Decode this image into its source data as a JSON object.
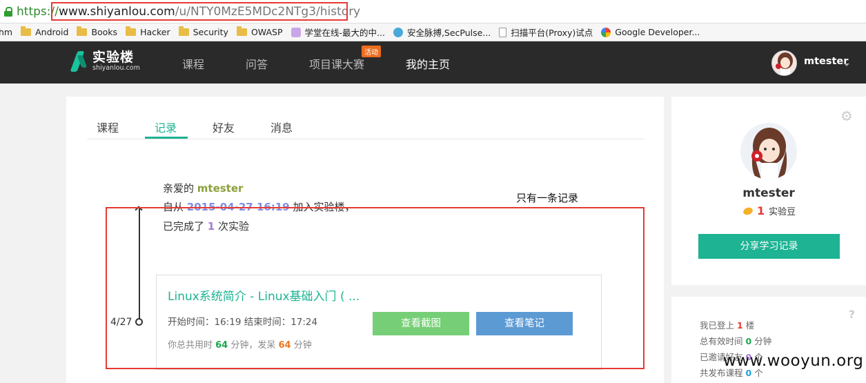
{
  "browser": {
    "url_scheme": "https",
    "url_sep": "://",
    "url_host": "www.shiyanlou.com",
    "url_path": "/u/NTY0MzE5MDc2NTg3/history",
    "bookmarks": [
      "hm",
      "Android",
      "Books",
      "Hacker",
      "Security",
      "OWASP",
      "学堂在线-最大的中...",
      "安全脉搏,SecPulse...",
      "扫描平台(Proxy)试点",
      "Google Developer..."
    ]
  },
  "nav": {
    "logo_cn": "实验楼",
    "logo_en": "shiyanlou.com",
    "links": [
      "课程",
      "问答",
      "项目课大赛",
      "我的主页"
    ],
    "badge": "活动",
    "username": "mtester"
  },
  "main": {
    "tabs": [
      "课程",
      "记录",
      "好友",
      "消息"
    ],
    "greeting": {
      "line1_prefix": "亲爱的 ",
      "user": "mtester",
      "line2_prefix": "自从 ",
      "join_date": "2015-04-27 16:19",
      "line2_suffix": " 加入实验楼，",
      "line3_prefix": "已完成了 ",
      "done_count": "1",
      "line3_suffix": " 次实验"
    },
    "timeline_date": "4/27",
    "record": {
      "title": "Linux系统简介 - Linux基础入门 ( ...",
      "start_label": "开始时间：",
      "start": "16:19",
      "end_label": " 结束时间：",
      "end": "17:24",
      "dur_prefix": "你总共用时 ",
      "used": "64",
      "dur_mid": " 分钟，发呆 ",
      "idle": "64",
      "dur_suffix": " 分钟",
      "btn_screenshot": "查看截图",
      "btn_note": "查看笔记"
    },
    "annotation": "只有一条记录"
  },
  "profile": {
    "name": "mtester",
    "beans": "1",
    "beans_label": "实验豆",
    "share_button": "分享学习记录"
  },
  "stats": {
    "login_label": "我已登上",
    "login": "1",
    "login_unit": "楼",
    "time_label": "总有效时间",
    "time": "0",
    "time_unit": "分钟",
    "invite_label": "已邀请好友",
    "invite": "0",
    "invite_unit": "个",
    "courses_label": "共发布课程",
    "courses": "0",
    "courses_unit": "个"
  },
  "watermark": "www.wooyun.org",
  "colors": {
    "accent": "#1db393",
    "annotation_red": "#e53935",
    "nav_bg": "#2a2a2a"
  }
}
